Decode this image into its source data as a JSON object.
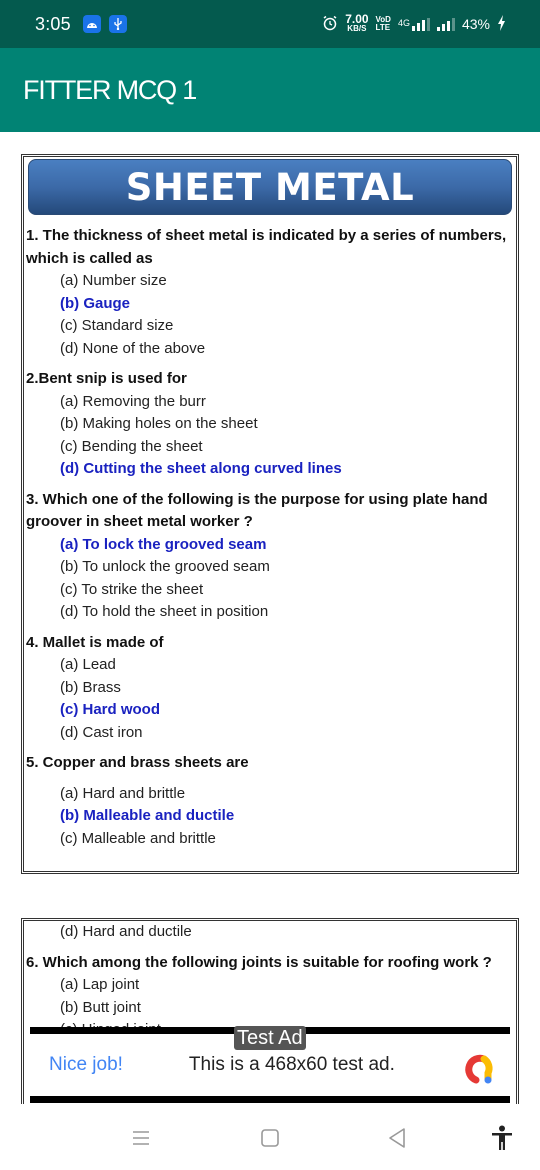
{
  "status_bar": {
    "time": "3:05",
    "notifications": [
      "android-icon",
      "usb-icon"
    ],
    "alarm": "alarm-icon",
    "net_speed_value": "7.00",
    "net_speed_unit": "KB/S",
    "volte_top": "VoD",
    "volte_bottom": "LTE",
    "network": "4G",
    "battery": "43%"
  },
  "app_bar": {
    "title": "FITTER MCQ 1"
  },
  "document": {
    "banner_title": "SHEET METAL",
    "questions": [
      {
        "text": "1. The thickness of sheet metal is indicated by a series of numbers, which is called as",
        "options": [
          "(a) Number size",
          "(b) Gauge",
          "(c) Standard size",
          "(d) None of the above"
        ],
        "answer_index": 1
      },
      {
        "text": "2.Bent snip is used for",
        "options": [
          "(a) Removing the burr",
          "(b) Making holes on the sheet",
          "(c) Bending the sheet",
          "(d) Cutting the sheet along curved lines"
        ],
        "answer_index": 3
      },
      {
        "text": "3. Which one of the following is the purpose for using plate hand groover in sheet metal worker ?",
        "options": [
          "(a) To lock the grooved seam",
          "(b) To unlock the grooved seam",
          "(c) To strike the sheet",
          "(d) To hold the sheet in position"
        ],
        "answer_index": 0
      },
      {
        "text": "4. Mallet is made of",
        "options": [
          "(a) Lead",
          "(b) Brass",
          "(c) Hard wood",
          "(d) Cast iron"
        ],
        "answer_index": 2
      },
      {
        "text": "5. Copper and brass sheets are",
        "options": [
          "(a) Hard and brittle",
          "(b) Malleable and ductile",
          "(c) Malleable and brittle",
          "(d) Hard and ductile"
        ],
        "answer_index": 1
      },
      {
        "text": "6. Which among the following joints is suitable for roofing work ?",
        "options": [
          "(a) Lap joint",
          "(b) Butt joint",
          "(c) Hinged joint"
        ],
        "answer_index": null
      }
    ],
    "answer_color": "#1a22c0"
  },
  "ad": {
    "label": "Test Ad",
    "headline": "Nice job!",
    "body": "This is a 468x60 test ad."
  },
  "nav_bar": {
    "buttons": [
      "recents-icon",
      "home-icon",
      "back-icon",
      "accessibility-icon"
    ]
  },
  "colors": {
    "status_bar": "#045a4e",
    "app_bar": "#018374",
    "banner": "#3c6aa8"
  }
}
